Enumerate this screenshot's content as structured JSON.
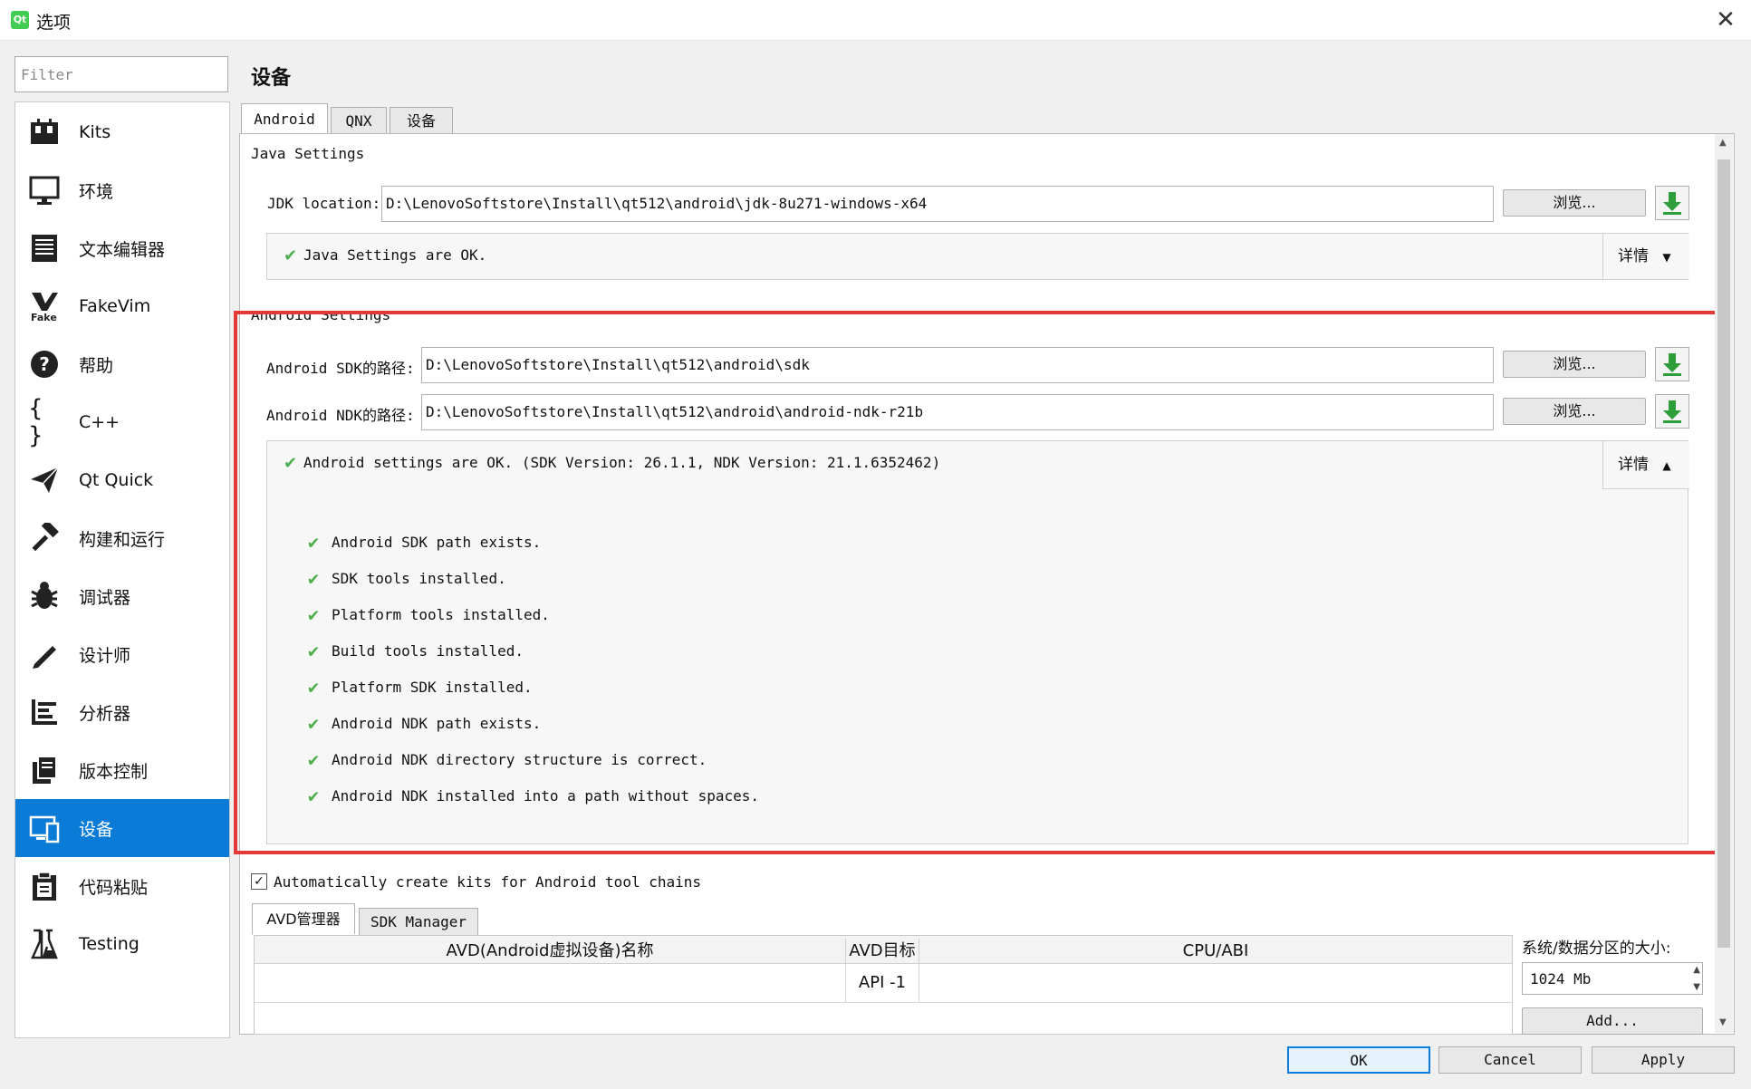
{
  "window": {
    "title": "选项",
    "app_icon_text": "Qt"
  },
  "filter": {
    "placeholder": "Filter"
  },
  "sidebar": {
    "items": [
      {
        "label": "Kits",
        "icon": "kits-icon"
      },
      {
        "label": "环境",
        "icon": "monitor-icon"
      },
      {
        "label": "文本编辑器",
        "icon": "text-editor-icon"
      },
      {
        "label": "FakeVim",
        "icon": "fakevim-icon"
      },
      {
        "label": "帮助",
        "icon": "help-icon"
      },
      {
        "label": "C++",
        "icon": "braces-icon"
      },
      {
        "label": "Qt Quick",
        "icon": "paper-plane-icon"
      },
      {
        "label": "构建和运行",
        "icon": "hammer-icon"
      },
      {
        "label": "调试器",
        "icon": "bug-icon"
      },
      {
        "label": "设计师",
        "icon": "pencil-icon"
      },
      {
        "label": "分析器",
        "icon": "analyzer-icon"
      },
      {
        "label": "版本控制",
        "icon": "version-control-icon"
      },
      {
        "label": "设备",
        "icon": "device-icon"
      },
      {
        "label": "代码粘贴",
        "icon": "clipboard-icon"
      },
      {
        "label": "Testing",
        "icon": "flask-icon"
      }
    ],
    "selected": "设备"
  },
  "page_title": "设备",
  "tabs": [
    "Android",
    "QNX",
    "设备"
  ],
  "java": {
    "group_label": "Java Settings",
    "jdk_label": "JDK location:",
    "jdk_value": "D:\\LenovoSoftstore\\Install\\qt512\\android\\jdk-8u271-windows-x64",
    "browse_label": "浏览...",
    "status": "Java Settings are OK.",
    "details_label": "详情"
  },
  "android": {
    "group_label": "Android Settings",
    "sdk_label": "Android SDK的路径:",
    "sdk_value": "D:\\LenovoSoftstore\\Install\\qt512\\android\\sdk",
    "ndk_label": "Android NDK的路径:",
    "ndk_value": "D:\\LenovoSoftstore\\Install\\qt512\\android\\android-ndk-r21b",
    "browse_label": "浏览...",
    "status": "Android settings are OK. (SDK Version: 26.1.1, NDK Version: 21.1.6352462)",
    "details_label": "详情",
    "checks": [
      "Android SDK path exists.",
      "SDK tools installed.",
      "Platform tools installed.",
      "Build tools installed.",
      "Platform SDK installed.",
      "Android NDK path exists.",
      "Android NDK directory structure is correct.",
      "Android NDK installed into a path without spaces."
    ]
  },
  "auto_kits_label": "Automatically create kits for Android tool chains",
  "avd": {
    "tabs": [
      "AVD管理器",
      "SDK Manager"
    ],
    "columns": [
      "AVD(Android虚拟设备)名称",
      "AVD目标",
      "CPU/ABI"
    ],
    "rows": [
      [
        "",
        "API -1",
        ""
      ]
    ],
    "partition_label": "系统/数据分区的大小:",
    "partition_value": "1024 Mb",
    "add_label": "Add..."
  },
  "buttons": {
    "ok": "OK",
    "cancel": "Cancel",
    "apply": "Apply"
  },
  "colors": {
    "accent": "#0a7bd6",
    "check": "#4caf50",
    "highlight": "#e53935",
    "download": "#2e9e3a"
  }
}
